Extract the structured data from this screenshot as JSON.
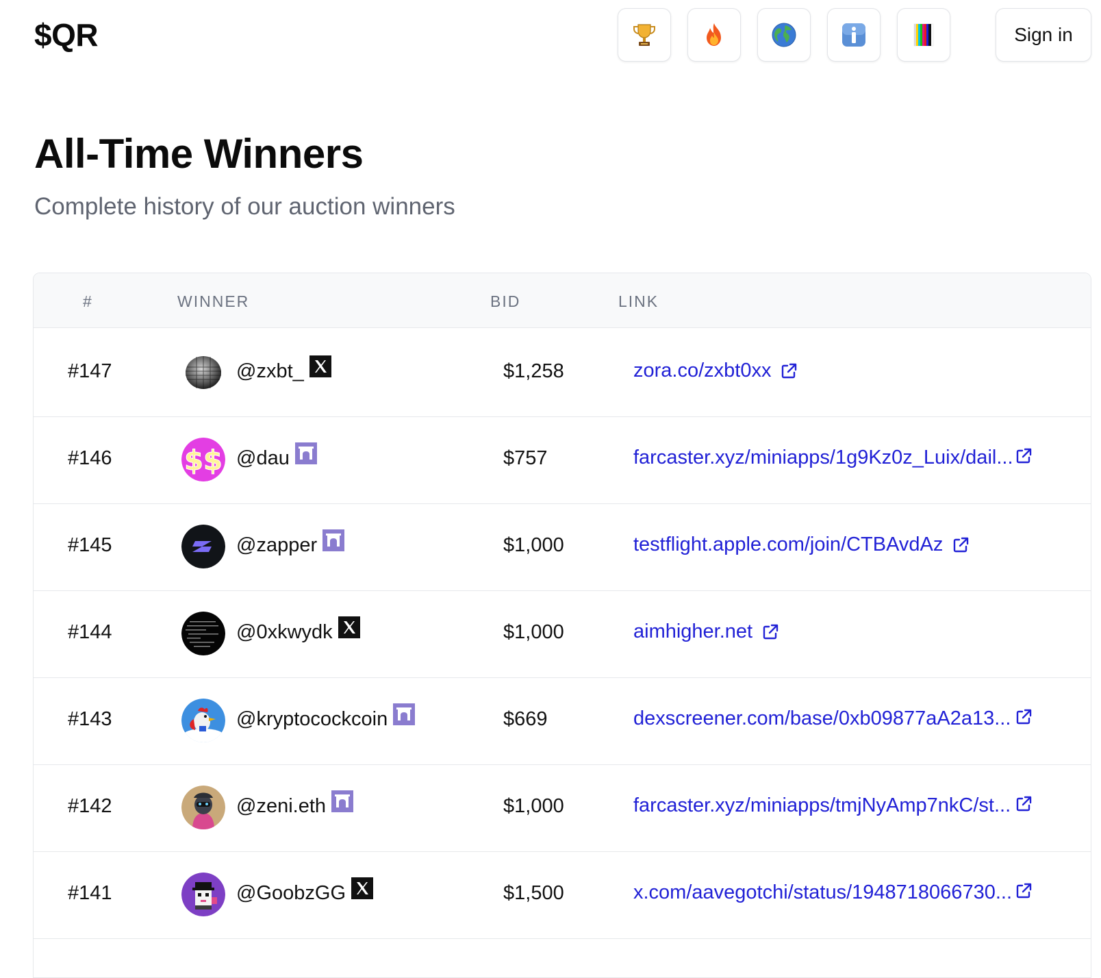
{
  "app": {
    "logo": "$QR"
  },
  "header": {
    "nav_icons": [
      {
        "name": "trophy-icon"
      },
      {
        "name": "fire-icon"
      },
      {
        "name": "globe-icon"
      },
      {
        "name": "info-icon"
      },
      {
        "name": "color-bars-icon"
      }
    ],
    "signin_label": "Sign in"
  },
  "page": {
    "title": "All-Time Winners",
    "subtitle": "Complete history of our auction winners"
  },
  "table": {
    "columns": [
      "#",
      "WINNER",
      "BID",
      "LINK"
    ],
    "rows": [
      {
        "num": "#147",
        "winner": "@zxbt_",
        "platform": "x-icon",
        "bid": "$1,258",
        "link": "zora.co/zxbt0xx",
        "link_truncated": false,
        "avatar": "dotted-sphere-avatar"
      },
      {
        "num": "#146",
        "winner": "@dau",
        "platform": "farcaster-icon",
        "bid": "$757",
        "link": "farcaster.xyz/miniapps/1g9Kz0z_Luix/dail...",
        "link_truncated": true,
        "avatar": "dollar-sign-avatar"
      },
      {
        "num": "#145",
        "winner": "@zapper",
        "platform": "farcaster-icon",
        "bid": "$1,000",
        "link": "testflight.apple.com/join/CTBAvdAz",
        "link_truncated": false,
        "avatar": "zapper-logo-avatar"
      },
      {
        "num": "#144",
        "winner": "@0xkwydk",
        "platform": "x-icon",
        "bid": "$1,000",
        "link": "aimhigher.net",
        "link_truncated": false,
        "avatar": "dark-text-avatar"
      },
      {
        "num": "#143",
        "winner": "@kryptocockcoin",
        "platform": "farcaster-icon",
        "bid": "$669",
        "link": "dexscreener.com/base/0xb09877aA2a13...",
        "link_truncated": true,
        "avatar": "rooster-hero-avatar"
      },
      {
        "num": "#142",
        "winner": "@zeni.eth",
        "platform": "farcaster-icon",
        "bid": "$1,000",
        "link": "farcaster.xyz/miniapps/tmjNyAmp7nkC/st...",
        "link_truncated": true,
        "avatar": "character-avatar"
      },
      {
        "num": "#141",
        "winner": "@GoobzGG",
        "platform": "x-icon",
        "bid": "$1,500",
        "link": "x.com/aavegotchi/status/1948718066730...",
        "link_truncated": true,
        "avatar": "pixel-ghost-avatar"
      }
    ]
  },
  "colors": {
    "link": "#2121d6",
    "farcaster": "#8a7ccf",
    "x_brand": "#111111",
    "muted_text": "#5f6470"
  }
}
